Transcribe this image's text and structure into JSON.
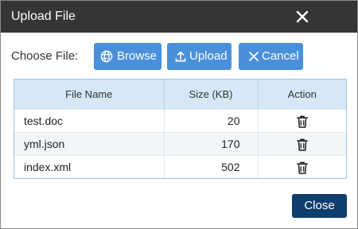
{
  "dialog": {
    "title": "Upload File",
    "close_icon": "close-icon"
  },
  "toolbar": {
    "choose_label": "Choose File:",
    "browse_label": "Browse",
    "browse_icon": "globe-icon",
    "upload_label": "Upload",
    "upload_icon": "upload-icon",
    "cancel_label": "Cancel",
    "cancel_icon": "close-icon"
  },
  "table": {
    "columns": [
      "File Name",
      "Size (KB)",
      "Action"
    ],
    "rows": [
      {
        "name": "test.doc",
        "size": "20",
        "action_icon": "trash-icon"
      },
      {
        "name": "yml.json",
        "size": "170",
        "action_icon": "trash-icon"
      },
      {
        "name": "index.xml",
        "size": "502",
        "action_icon": "trash-icon"
      }
    ]
  },
  "footer": {
    "close_label": "Close"
  },
  "colors": {
    "titlebar": "#353535",
    "button_blue": "#4a8fd9",
    "close_button": "#0e3e6e",
    "header_bg": "#d6e8f7"
  }
}
